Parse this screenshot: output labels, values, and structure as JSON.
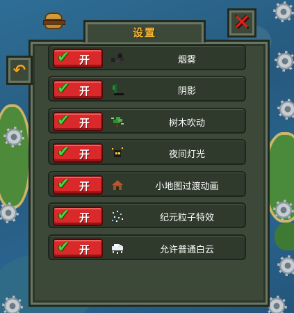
{
  "dialog": {
    "title": "设置"
  },
  "settings": [
    {
      "label": "烟雾",
      "toggle": "开",
      "enabled": true,
      "icon": "smoke-icon"
    },
    {
      "label": "阴影",
      "toggle": "开",
      "enabled": true,
      "icon": "shadow-icon"
    },
    {
      "label": "树木吹动",
      "toggle": "开",
      "enabled": true,
      "icon": "tree-wind-icon"
    },
    {
      "label": "夜间灯光",
      "toggle": "开",
      "enabled": true,
      "icon": "night-light-icon"
    },
    {
      "label": "小地图过渡动画",
      "toggle": "开",
      "enabled": true,
      "icon": "house-icon"
    },
    {
      "label": "纪元粒子特效",
      "toggle": "开",
      "enabled": true,
      "icon": "particle-icon"
    },
    {
      "label": "允许普通白云",
      "toggle": "开",
      "enabled": true,
      "icon": "cloud-icon"
    }
  ],
  "colors": {
    "title": "#f4b735",
    "toggle_on": "#d9292b",
    "checkmark": "#4fd13a",
    "close": "#e0231d",
    "back": "#f1a723",
    "panel": "#3c4838"
  }
}
